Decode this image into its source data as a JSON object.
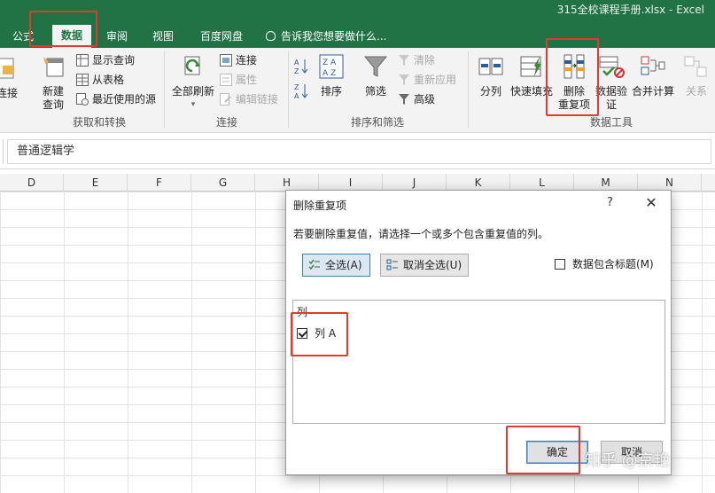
{
  "window": {
    "title": "315全校课程手册.xlsx  -  Excel"
  },
  "tabs": [
    {
      "label": "公式",
      "active": false
    },
    {
      "label": "数据",
      "active": true
    },
    {
      "label": "审阅",
      "active": false
    },
    {
      "label": "视图",
      "active": false
    },
    {
      "label": "百度网盘",
      "active": false
    }
  ],
  "tell_me": "告诉我您想要做什么...",
  "ribbon": {
    "groups": {
      "get_transform": "获取和转换",
      "connections": "连接",
      "sort_filter": "排序和筛选",
      "data_tools": "数据工具"
    },
    "buttons": {
      "conn_partial": "连接",
      "new_query_line1": "新建",
      "new_query_line2": "查询",
      "show_queries": "显示查询",
      "from_table": "从表格",
      "recent_sources": "最近使用的源",
      "refresh_all": "全部刷新",
      "connections": "连接",
      "properties": "属性",
      "edit_links": "编辑链接",
      "sort": "排序",
      "filter": "筛选",
      "clear": "清除",
      "reapply": "重新应用",
      "advanced": "高级",
      "text_to_columns": "分列",
      "flash_fill": "快速填充",
      "remove_dup_line1": "删除",
      "remove_dup_line2": "重复项",
      "validation_line1": "数据验",
      "validation_line2": "证",
      "consolidate": "合并计算",
      "relationships": "关系"
    }
  },
  "formula_bar": {
    "value": "普通逻辑学"
  },
  "columns": [
    "D",
    "E",
    "F",
    "G",
    "H",
    "I",
    "J",
    "K",
    "L",
    "M",
    "N"
  ],
  "dialog": {
    "title": "删除重复项",
    "help": "?",
    "close": "✕",
    "description": "若要删除重复值，请选择一个或多个包含重复值的列。",
    "select_all": "全选(A)",
    "unselect_all": "取消全选(U)",
    "has_headers_label": "数据包含标题(M)",
    "has_headers_checked": false,
    "list_header": "列",
    "columns": [
      {
        "label": "列 A",
        "checked": true
      }
    ],
    "ok": "确定",
    "cancel": "取消"
  },
  "watermark": "知乎 @京艳",
  "colors": {
    "excel_green": "#217346",
    "highlight_red": "#e23a2e"
  }
}
